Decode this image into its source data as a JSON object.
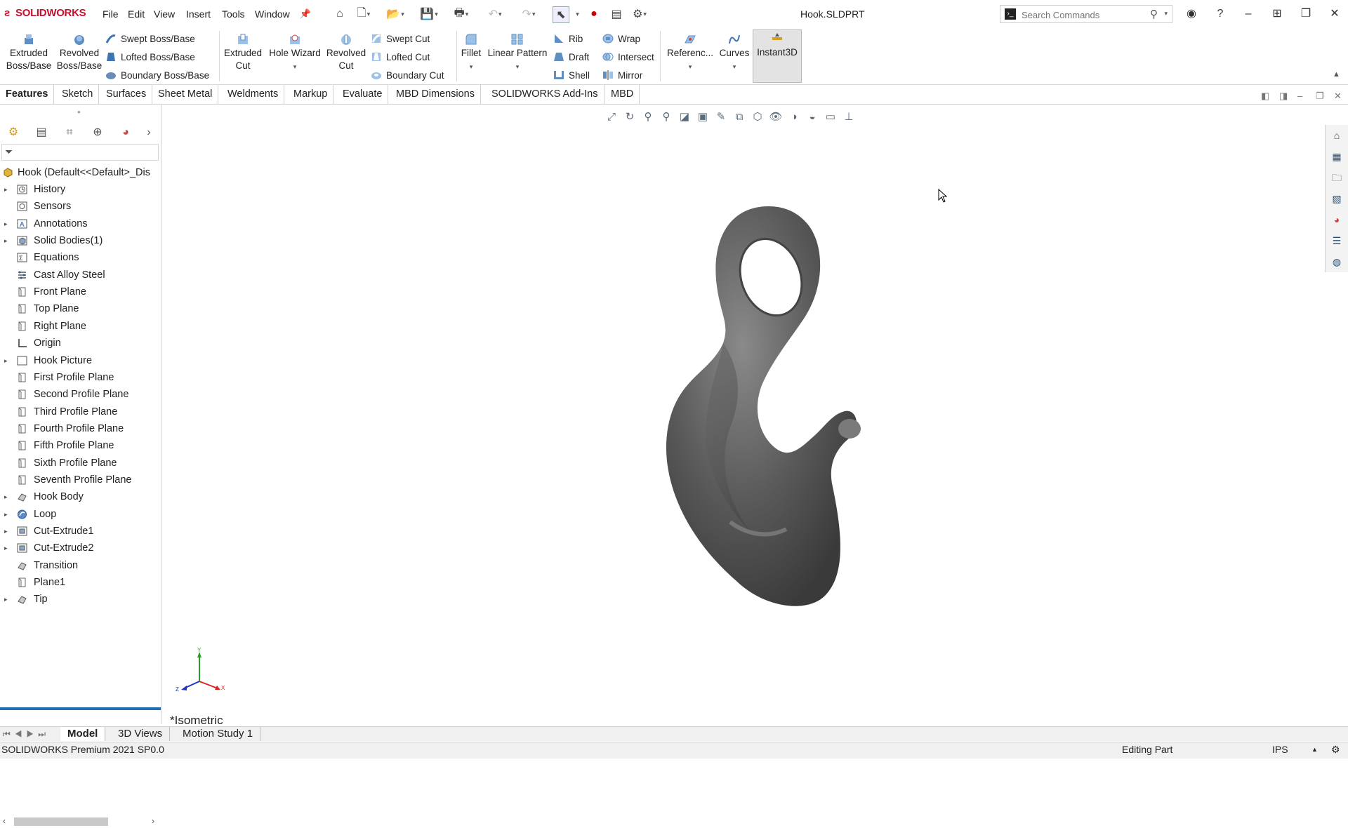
{
  "app": {
    "brand": "SOLIDWORKS",
    "document_title": "Hook.SLDPRT"
  },
  "menu": [
    "File",
    "Edit",
    "View",
    "Insert",
    "Tools",
    "Window"
  ],
  "search": {
    "placeholder": "Search Commands"
  },
  "commands": {
    "extruded_boss": "Extruded Boss/Base",
    "revolved_boss": "Revolved Boss/Base",
    "swept_boss": "Swept Boss/Base",
    "lofted_boss": "Lofted Boss/Base",
    "boundary_boss": "Boundary Boss/Base",
    "extruded_cut": "Extruded Cut",
    "hole_wizard": "Hole Wizard",
    "revolved_cut": "Revolved Cut",
    "swept_cut": "Swept Cut",
    "lofted_cut": "Lofted Cut",
    "boundary_cut": "Boundary Cut",
    "fillet": "Fillet",
    "linear_pattern": "Linear Pattern",
    "rib": "Rib",
    "draft": "Draft",
    "shell": "Shell",
    "wrap": "Wrap",
    "intersect": "Intersect",
    "mirror": "Mirror",
    "reference": "Referenc...",
    "curves": "Curves",
    "instant3d": "Instant3D"
  },
  "tabs": [
    "Features",
    "Sketch",
    "Surfaces",
    "Sheet Metal",
    "Weldments",
    "Markup",
    "Evaluate",
    "MBD Dimensions",
    "SOLIDWORKS Add-Ins",
    "MBD"
  ],
  "tree": {
    "root": "Hook  (Default<<Default>_Dis",
    "items": [
      {
        "label": "History",
        "icon": "history-icon",
        "expandable": true
      },
      {
        "label": "Sensors",
        "icon": "sensors-icon",
        "expandable": false
      },
      {
        "label": "Annotations",
        "icon": "annotations-icon",
        "expandable": true
      },
      {
        "label": "Solid Bodies(1)",
        "icon": "solid-bodies-icon",
        "expandable": true
      },
      {
        "label": "Equations",
        "icon": "equations-icon",
        "expandable": false
      },
      {
        "label": "Cast Alloy Steel",
        "icon": "material-icon",
        "expandable": false
      },
      {
        "label": "Front Plane",
        "icon": "plane-icon",
        "expandable": false
      },
      {
        "label": "Top Plane",
        "icon": "plane-icon",
        "expandable": false
      },
      {
        "label": "Right Plane",
        "icon": "plane-icon",
        "expandable": false
      },
      {
        "label": "Origin",
        "icon": "origin-icon",
        "expandable": false
      },
      {
        "label": "Hook Picture",
        "icon": "sketch-picture-icon",
        "expandable": true
      },
      {
        "label": "First Profile Plane",
        "icon": "plane-icon",
        "expandable": false
      },
      {
        "label": "Second Profile Plane",
        "icon": "plane-icon",
        "expandable": false
      },
      {
        "label": "Third Profile Plane",
        "icon": "plane-icon",
        "expandable": false
      },
      {
        "label": "Fourth Profile Plane",
        "icon": "plane-icon",
        "expandable": false
      },
      {
        "label": "Fifth Profile Plane",
        "icon": "plane-icon",
        "expandable": false
      },
      {
        "label": "Sixth Profile Plane",
        "icon": "plane-icon",
        "expandable": false
      },
      {
        "label": "Seventh Profile Plane",
        "icon": "plane-icon",
        "expandable": false
      },
      {
        "label": "Hook Body",
        "icon": "loft-icon",
        "expandable": true
      },
      {
        "label": "Loop",
        "icon": "sweep-icon",
        "expandable": true
      },
      {
        "label": "Cut-Extrude1",
        "icon": "cut-extrude-icon",
        "expandable": true
      },
      {
        "label": "Cut-Extrude2",
        "icon": "cut-extrude-icon",
        "expandable": true
      },
      {
        "label": "Transition",
        "icon": "loft-icon",
        "expandable": false
      },
      {
        "label": "Plane1",
        "icon": "plane-icon",
        "expandable": false
      },
      {
        "label": "Tip",
        "icon": "loft-icon",
        "expandable": true
      }
    ]
  },
  "viewport": {
    "view_label": "*Isometric",
    "triad": {
      "x": "X",
      "y": "Y",
      "z": "Z"
    }
  },
  "bottom_tabs": [
    "Model",
    "3D Views",
    "Motion Study 1"
  ],
  "status": {
    "product": "SOLIDWORKS Premium 2021 SP0.0",
    "mode": "Editing Part",
    "units": "IPS"
  },
  "colors": {
    "brand_red": "#c8102e",
    "rollback_blue": "#1e6fb4",
    "model_gray": "#5a5a5a"
  }
}
